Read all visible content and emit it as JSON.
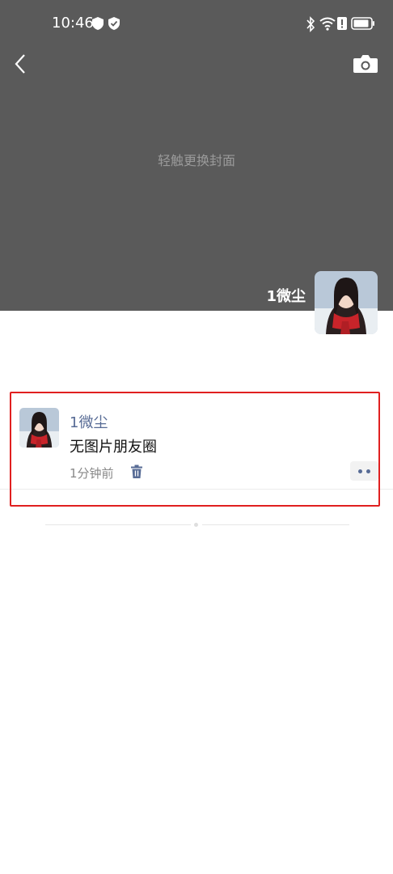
{
  "status_bar": {
    "time": "10:46",
    "left_icons": [
      "shield-icon",
      "verified-shield-icon"
    ],
    "right_icons": [
      "bluetooth-icon",
      "wifi-icon",
      "alert-icon",
      "battery-icon"
    ]
  },
  "header": {
    "back_icon": "back-chevron-icon",
    "camera_icon": "camera-icon"
  },
  "cover": {
    "hint": "轻触更换封面",
    "background_color": "#5a5a5a"
  },
  "profile": {
    "name": "1微尘"
  },
  "posts": [
    {
      "author": "1微尘",
      "text": "无图片朋友圈",
      "time": "1分钟前",
      "delete_icon": "trash-icon",
      "more_icon": "more-dots-icon"
    }
  ],
  "colors": {
    "link_blue": "#576b95",
    "highlight_red": "#e02020"
  }
}
